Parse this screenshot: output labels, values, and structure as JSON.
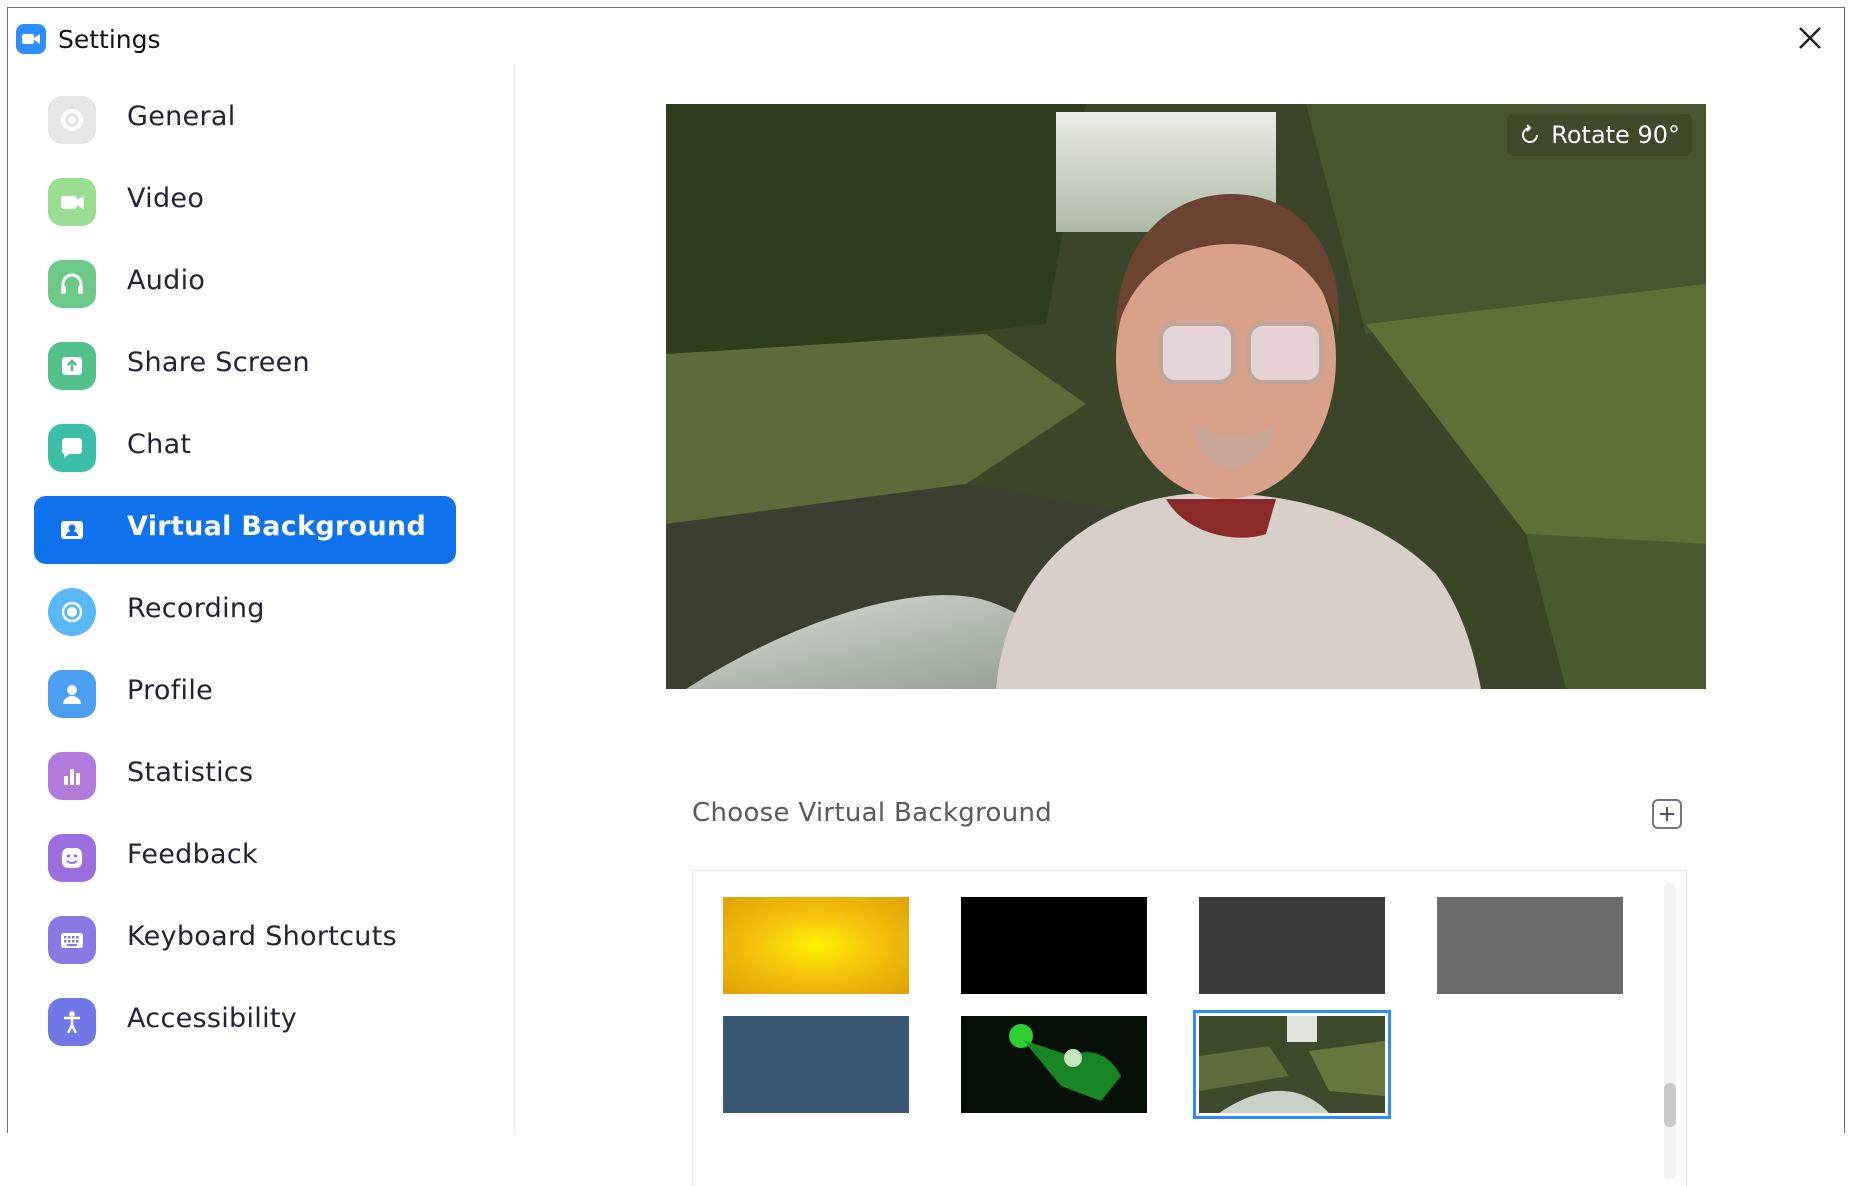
{
  "window": {
    "title": "Settings"
  },
  "sidebar": {
    "items": [
      {
        "label": "General",
        "icon": "gear-icon",
        "color": "#e4e4e4",
        "active": false
      },
      {
        "label": "Video",
        "icon": "video-camera-icon",
        "color": "#9bdd93",
        "active": false
      },
      {
        "label": "Audio",
        "icon": "headphones-icon",
        "color": "#6dc98a",
        "active": false
      },
      {
        "label": "Share Screen",
        "icon": "share-screen-icon",
        "color": "#50c28a",
        "active": false
      },
      {
        "label": "Chat",
        "icon": "chat-bubble-icon",
        "color": "#3dbfa7",
        "active": false
      },
      {
        "label": "Virtual Background",
        "icon": "portrait-icon",
        "color": "#0e72ed",
        "active": true
      },
      {
        "label": "Recording",
        "icon": "record-icon",
        "color": "#59b7f5",
        "active": false
      },
      {
        "label": "Profile",
        "icon": "person-icon",
        "color": "#4c9ff0",
        "active": false
      },
      {
        "label": "Statistics",
        "icon": "bar-chart-icon",
        "color": "#b37ad9",
        "active": false
      },
      {
        "label": "Feedback",
        "icon": "smiley-icon",
        "color": "#9b6fe0",
        "active": false
      },
      {
        "label": "Keyboard Shortcuts",
        "icon": "keyboard-icon",
        "color": "#8a79e4",
        "active": false
      },
      {
        "label": "Accessibility",
        "icon": "accessibility-icon",
        "color": "#6f78e6",
        "active": false
      }
    ]
  },
  "preview": {
    "rotate_label": "Rotate 90°"
  },
  "backgrounds": {
    "title": "Choose Virtual Background",
    "items": [
      {
        "name": "yellow-gradient",
        "color": "#f1c232",
        "selected": false
      },
      {
        "name": "black",
        "color": "#000000",
        "selected": false
      },
      {
        "name": "dark-gray",
        "color": "#3a3a3a",
        "selected": false
      },
      {
        "name": "gray",
        "color": "#6b6b6b",
        "selected": false
      },
      {
        "name": "slate-blue",
        "color": "#3b5670",
        "selected": false
      },
      {
        "name": "space-hero",
        "color": "#061006",
        "selected": false
      },
      {
        "name": "waterfall",
        "color": "#4a5a3a",
        "selected": true
      }
    ]
  },
  "colors": {
    "accent": "#0e72ed",
    "selection": "#2d8cff"
  }
}
